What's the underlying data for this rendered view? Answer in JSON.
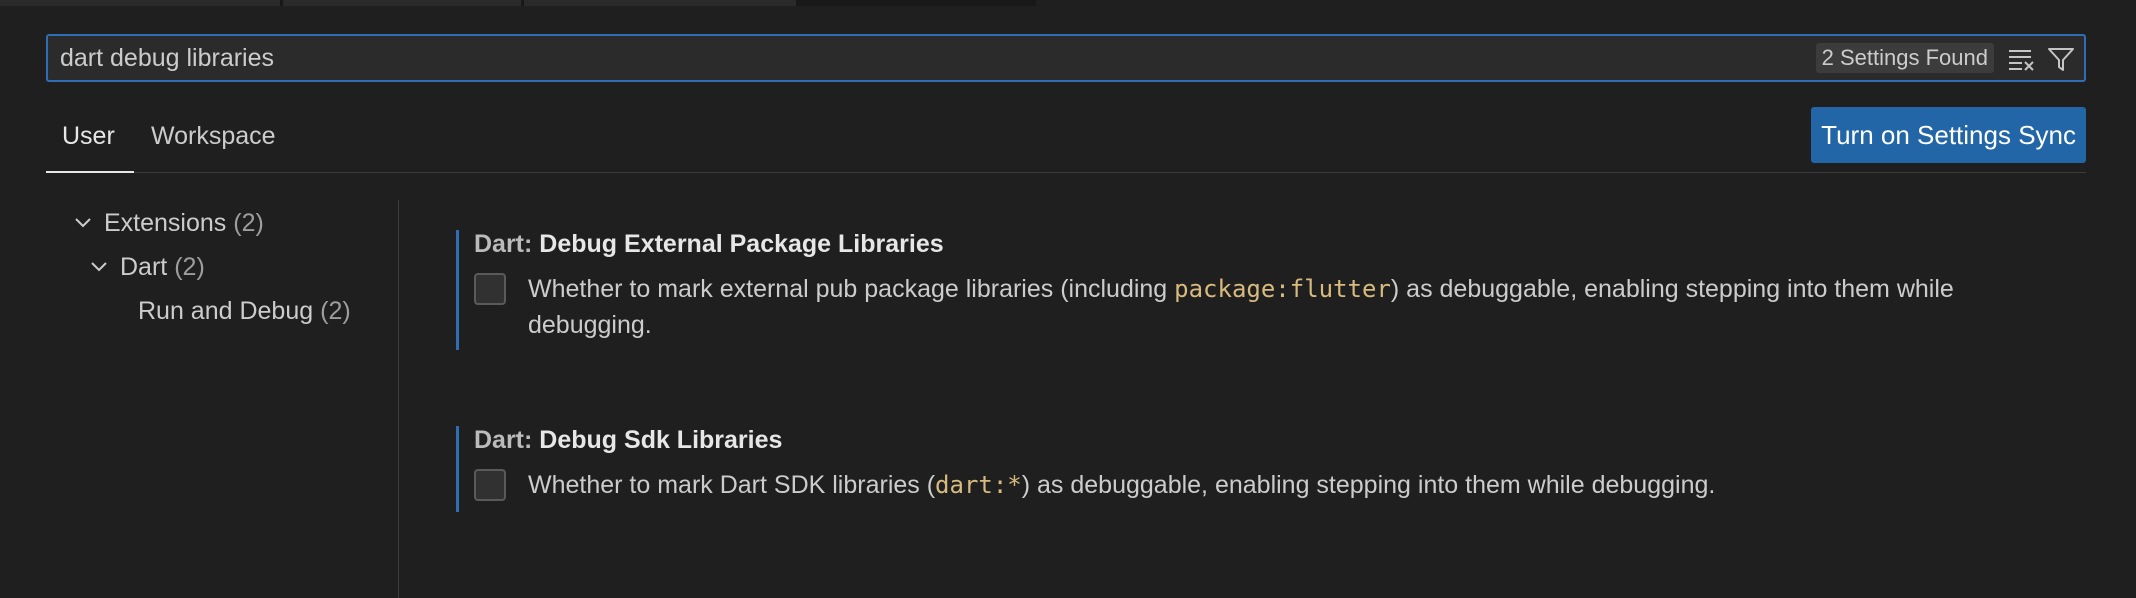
{
  "search": {
    "value": "dart debug libraries",
    "count_label": "2 Settings Found",
    "clear_icon": "clear-filter-icon",
    "filter_icon": "filter-icon"
  },
  "tabs": [
    {
      "label": "User",
      "active": true
    },
    {
      "label": "Workspace",
      "active": false
    }
  ],
  "sync_button": {
    "label": "Turn on Settings Sync"
  },
  "toc": {
    "items": [
      {
        "label": "Extensions",
        "count": "(2)",
        "expanded": true
      },
      {
        "label": "Dart",
        "count": "(2)",
        "expanded": true
      },
      {
        "label": "Run and Debug",
        "count": "(2)"
      }
    ]
  },
  "settings": [
    {
      "category": "Dart: ",
      "name": "Debug External Package Libraries",
      "desc_before": "Whether to mark external pub package libraries (including ",
      "desc_code": "package:flutter",
      "desc_after": ") as debuggable, enabling stepping into them while debugging.",
      "checked": false
    },
    {
      "category": "Dart: ",
      "name": "Debug Sdk Libraries",
      "desc_before": "Whether to mark Dart SDK libraries (",
      "desc_code": "dart:*",
      "desc_after": ") as debuggable, enabling stepping into them while debugging.",
      "checked": false
    }
  ],
  "colors": {
    "accent": "#2f6db5",
    "button": "#2266a7",
    "code": "#d7ba7d",
    "background": "#1f1f1f"
  }
}
